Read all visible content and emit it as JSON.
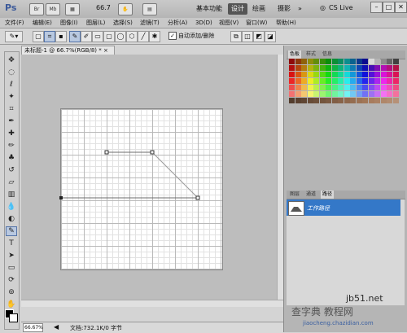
{
  "appbar": {
    "logo": "Ps",
    "icon_mb": "Mb",
    "zoom": "66.7",
    "workspaces": [
      "基本功能",
      "设计",
      "绘画",
      "摄影"
    ],
    "more": "»",
    "cs_live": "CS Live"
  },
  "menu": [
    "文件(F)",
    "编辑(E)",
    "图像(I)",
    "图层(L)",
    "选择(S)",
    "滤镜(T)",
    "分析(A)",
    "3D(D)",
    "视图(V)",
    "窗口(W)",
    "帮助(H)"
  ],
  "options": {
    "auto_add_delete": "自动添加/删除"
  },
  "document": {
    "tab_title": "未标题-1 @ 66.7%(RGB/8) *"
  },
  "status": {
    "zoom": "66.67%",
    "doc_info": "文档:732.1K/0 字节"
  },
  "panels": {
    "top_tabs": [
      "色板",
      "样式",
      "信息"
    ],
    "bottom_tabs": [
      "图层",
      "通道",
      "路径"
    ],
    "work_path": "工作路径"
  },
  "watermark": {
    "site": "jb51.net",
    "cn": "查字典 教程网",
    "url": "jiaocheng.chazidian.com"
  },
  "colors": {
    "accent": "#3478c8",
    "path_line": "#8a8a8a"
  }
}
